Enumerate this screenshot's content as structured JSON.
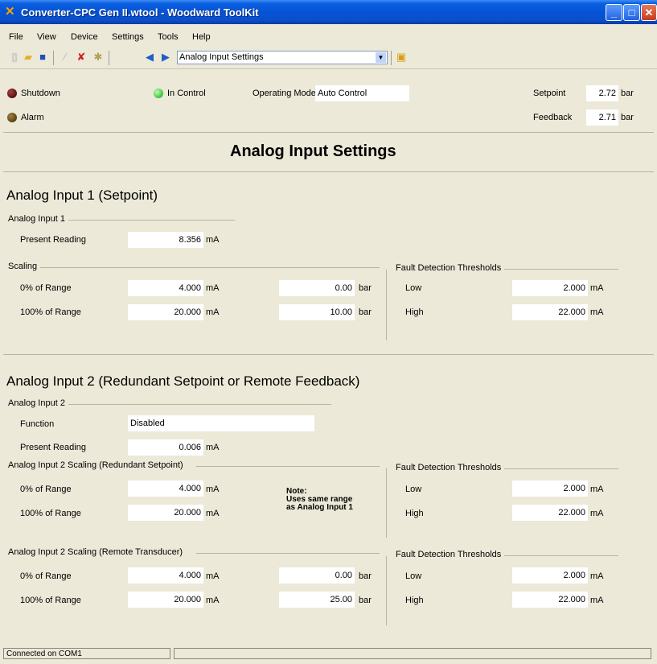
{
  "window": {
    "title": "Converter-CPC Gen II.wtool - Woodward ToolKit"
  },
  "menu": [
    "File",
    "View",
    "Device",
    "Settings",
    "Tools",
    "Help"
  ],
  "toolbar": {
    "nav_page": "Analog Input Settings"
  },
  "status": {
    "shutdown": "Shutdown",
    "alarm": "Alarm",
    "in_control": "In Control",
    "operating_mode_label": "Operating Mode",
    "operating_mode_value": "Auto Control",
    "setpoint_label": "Setpoint",
    "setpoint_value": "2.72",
    "setpoint_unit": "bar",
    "feedback_label": "Feedback",
    "feedback_value": "2.71",
    "feedback_unit": "bar",
    "colors": {
      "shutdown_led": "#5a0a0a",
      "alarm_led": "#5a4a10",
      "in_control_led": "#22c022"
    }
  },
  "page_title": "Analog Input Settings",
  "ai1": {
    "heading": "Analog Input 1 (Setpoint)",
    "group": "Analog Input 1",
    "present_reading_label": "Present Reading",
    "present_reading_value": "8.356",
    "present_reading_unit": "mA",
    "scaling_group": "Scaling",
    "row0_label": "0% of Range",
    "row0_ma": "4.000",
    "row0_bar": "0.00",
    "row100_label": "100% of Range",
    "row100_ma": "20.000",
    "row100_bar": "10.00",
    "unit_ma": "mA",
    "unit_bar": "bar",
    "fault_group": "Fault Detection Thresholds",
    "low_label": "Low",
    "low_value": "2.000",
    "high_label": "High",
    "high_value": "22.000"
  },
  "ai2": {
    "heading": "Analog Input 2 (Redundant Setpoint or Remote Feedback)",
    "group": "Analog Input 2",
    "function_label": "Function",
    "function_value": "Disabled",
    "present_reading_label": "Present Reading",
    "present_reading_value": "0.006",
    "present_reading_unit": "mA",
    "red_group": "Analog Input 2 Scaling (Redundant Setpoint)",
    "red_row0_label": "0% of Range",
    "red_row0_ma": "4.000",
    "red_row100_label": "100% of Range",
    "red_row100_ma": "20.000",
    "note": "Note:\nUses same range\nas Analog Input 1",
    "red_fault_group": "Fault Detection Thresholds",
    "red_low_label": "Low",
    "red_low_value": "2.000",
    "red_high_label": "High",
    "red_high_value": "22.000",
    "rem_group": "Analog Input 2 Scaling (Remote Transducer)",
    "rem_row0_label": "0% of Range",
    "rem_row0_ma": "4.000",
    "rem_row0_bar": "0.00",
    "rem_row100_label": "100% of Range",
    "rem_row100_ma": "20.000",
    "rem_row100_bar": "25.00",
    "rem_fault_group": "Fault Detection Thresholds",
    "rem_low_label": "Low",
    "rem_low_value": "2.000",
    "rem_high_label": "High",
    "rem_high_value": "22.000",
    "unit_ma": "mA",
    "unit_bar": "bar"
  },
  "statusbar": {
    "connection": "Connected on COM1"
  },
  "icons": [
    "app-icon",
    "minimize-icon",
    "maximize-icon",
    "close-icon",
    "new-file-icon",
    "open-folder-icon",
    "save-icon",
    "connect-icon",
    "disconnect-icon",
    "settings-wizard-icon",
    "back-arrow-icon",
    "forward-arrow-icon",
    "dropdown-arrow-icon",
    "page-properties-icon"
  ]
}
